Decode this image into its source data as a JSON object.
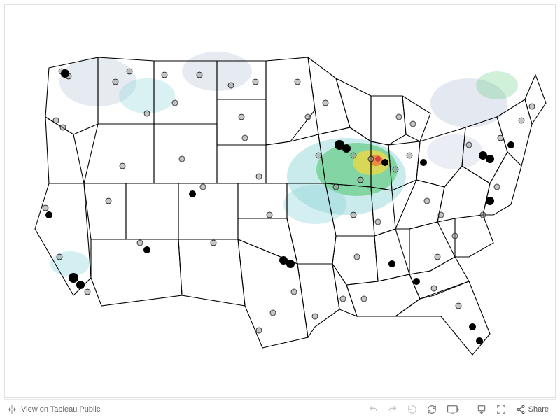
{
  "toolbar": {
    "view_label": "View on Tableau Public",
    "share_label": "Share"
  },
  "map": {
    "region": "United States (contiguous)",
    "layers": [
      {
        "name": "state-boundaries",
        "style": "black outline"
      },
      {
        "name": "weather-radar",
        "style": "heatmap (blue→green→yellow→red)",
        "concentration": "Ohio/Indiana/Illinois region"
      },
      {
        "name": "point-markers",
        "style": "gray circles with black outline",
        "count_estimate": 300
      }
    ],
    "radar_scale": [
      "#b7c4da",
      "#7fcfd4",
      "#49c36d",
      "#e2d22a",
      "#e07e1e",
      "#d52020"
    ],
    "marker_clusters": [
      "Seattle area",
      "Portland OR",
      "San Francisco Bay",
      "Los Angeles / San Diego",
      "Phoenix",
      "Denver",
      "Dallas–Fort Worth",
      "Houston",
      "Chicago",
      "Columbus/Cleveland",
      "Pittsburgh",
      "Washington–Baltimore",
      "New York / NJ",
      "Boston",
      "Atlanta",
      "Tampa / Orlando / Miami"
    ]
  },
  "controls": {
    "undo": "Undo",
    "redo": "Redo",
    "revert": "Revert",
    "refresh": "Refresh",
    "pause": "Pause updates",
    "device": "Device preview",
    "download": "Download",
    "fullscreen": "Full Screen"
  }
}
